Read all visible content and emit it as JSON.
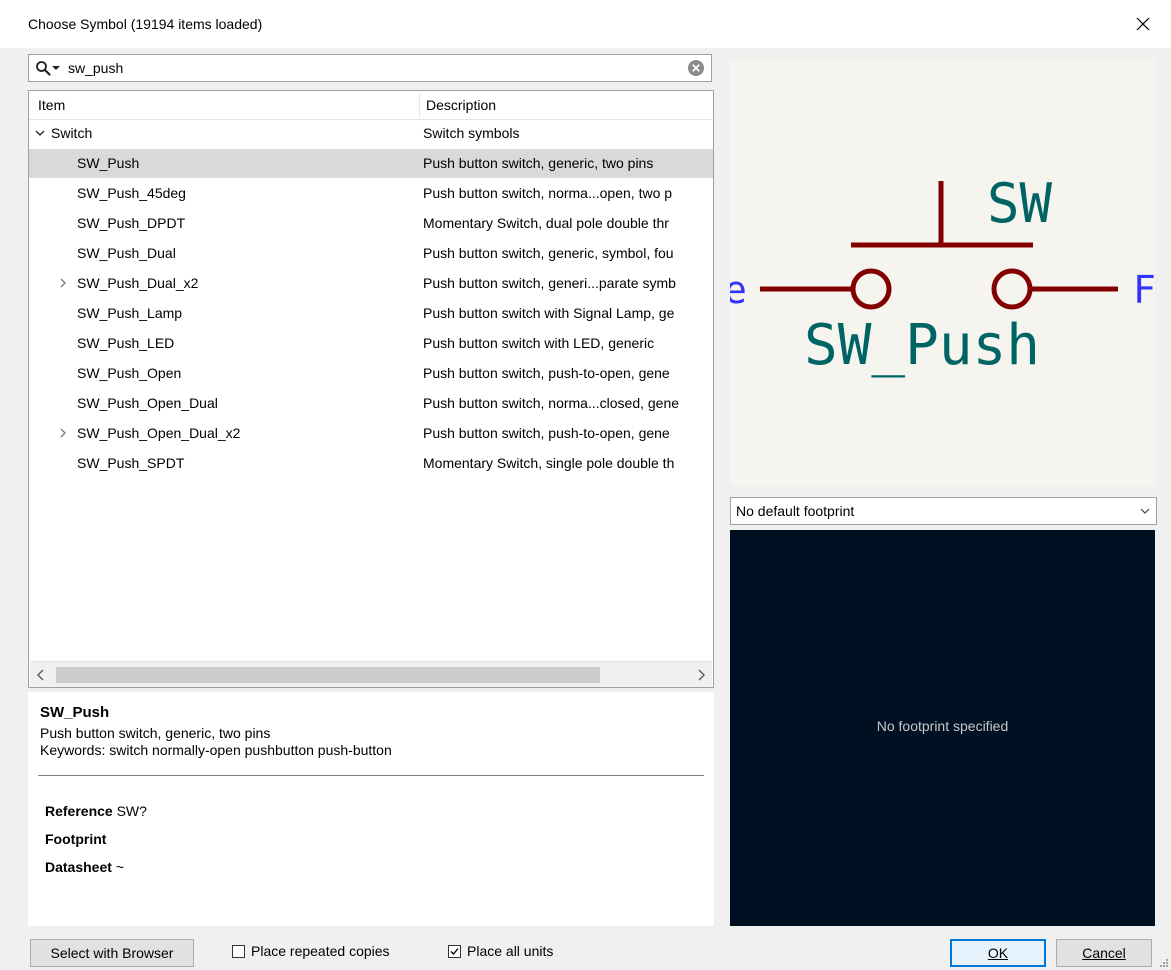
{
  "window": {
    "title": "Choose Symbol (19194 items loaded)"
  },
  "search": {
    "value": "sw_push"
  },
  "tree": {
    "columns": [
      "Item",
      "Description"
    ],
    "rows": [
      {
        "item": "Switch",
        "description": "Switch symbols",
        "level": 0,
        "expander": "expanded"
      },
      {
        "item": "SW_Push",
        "description": "Push button switch, generic, two pins",
        "level": 1,
        "expander": "",
        "selected": true
      },
      {
        "item": "SW_Push_45deg",
        "description": "Push button switch, norma...open, two p",
        "level": 1,
        "expander": ""
      },
      {
        "item": "SW_Push_DPDT",
        "description": "Momentary Switch, dual pole double thr",
        "level": 1,
        "expander": ""
      },
      {
        "item": "SW_Push_Dual",
        "description": "Push button switch, generic, symbol, fou",
        "level": 1,
        "expander": ""
      },
      {
        "item": "SW_Push_Dual_x2",
        "description": "Push button switch, generi...parate symb",
        "level": 1,
        "expander": "collapsed"
      },
      {
        "item": "SW_Push_Lamp",
        "description": "Push button switch with Signal Lamp, ge",
        "level": 1,
        "expander": ""
      },
      {
        "item": "SW_Push_LED",
        "description": "Push button switch with LED, generic",
        "level": 1,
        "expander": ""
      },
      {
        "item": "SW_Push_Open",
        "description": "Push button switch, push-to-open, gene",
        "level": 1,
        "expander": ""
      },
      {
        "item": "SW_Push_Open_Dual",
        "description": "Push button switch, norma...closed, gene",
        "level": 1,
        "expander": ""
      },
      {
        "item": "SW_Push_Open_Dual_x2",
        "description": "Push button switch, push-to-open, gene",
        "level": 1,
        "expander": "collapsed"
      },
      {
        "item": "SW_Push_SPDT",
        "description": "Momentary Switch, single pole double th",
        "level": 1,
        "expander": ""
      }
    ]
  },
  "details": {
    "name": "SW_Push",
    "description": "Push button switch, generic, two pins",
    "keywords": "Keywords: switch normally-open pushbutton push-button",
    "fields": [
      {
        "label": "Reference",
        "value": "SW?"
      },
      {
        "label": "Footprint",
        "value": ""
      },
      {
        "label": "Datasheet",
        "value": "~"
      }
    ]
  },
  "symbol_preview": {
    "reference": "SW",
    "value": "SW_Push",
    "pin_left_fragment": "e",
    "pin_right_fragment": "F",
    "colors": {
      "body": "#840000",
      "text": "#006464",
      "pin_text": "#3333ff",
      "background": "#f5f4ef"
    }
  },
  "footprint": {
    "selected": "No default footprint",
    "message": "No footprint specified",
    "background": "#001023"
  },
  "bottom": {
    "select_browser": "Select with Browser",
    "place_repeated": "Place repeated copies",
    "place_repeated_checked": false,
    "place_all_units": "Place all units",
    "place_all_units_checked": true,
    "ok": "OK",
    "cancel": "Cancel"
  }
}
